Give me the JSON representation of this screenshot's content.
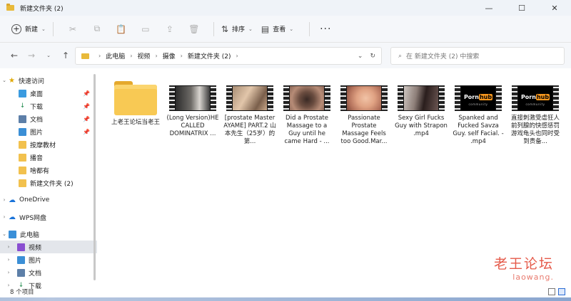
{
  "window": {
    "title": "新建文件夹 (2)",
    "controls": [
      "—",
      "☐",
      "✕"
    ]
  },
  "toolbar": {
    "new_label": "新建",
    "sort_label": "排序",
    "view_label": "查看",
    "more": "···"
  },
  "address": {
    "crumbs": [
      "此电脑",
      "视频",
      "摄像",
      "新建文件夹 (2)"
    ],
    "search_placeholder": "在 新建文件夹 (2) 中搜索"
  },
  "sidebar": {
    "quick_access": "快速访问",
    "items": [
      {
        "label": "桌面",
        "pinned": true
      },
      {
        "label": "下载",
        "pinned": true
      },
      {
        "label": "文档",
        "pinned": true
      },
      {
        "label": "图片",
        "pinned": true
      },
      {
        "label": "按摩教材"
      },
      {
        "label": "播音"
      },
      {
        "label": "啥都有"
      },
      {
        "label": "新建文件夹 (2)"
      }
    ],
    "onedrive": "OneDrive",
    "wps": "WPS网盘",
    "this_pc": "此电脑",
    "pc_items": [
      "视频",
      "图片",
      "文档",
      "下载"
    ]
  },
  "files": [
    {
      "name": "上老王论坛当老王",
      "type": "folder"
    },
    {
      "name": "(Long Version)HE CALLED DOMINATRIX ...",
      "type": "video"
    },
    {
      "name": "[prostate Master AYAME] PART.2 山本先生（25岁）的第...",
      "type": "video"
    },
    {
      "name": "Did a Prostate Massage to a Guy until he came Hard - ...",
      "type": "video"
    },
    {
      "name": "Passionate Prostate Massage Feels too Good.Mar...",
      "type": "video"
    },
    {
      "name": "Sexy Girl Fucks Guy with Strapon .mp4",
      "type": "video"
    },
    {
      "name": "Spanked and Fucked Savza Guy. self Facial. - .mp4",
      "type": "video",
      "brand": "Porn hub"
    },
    {
      "name": "直接刺激受虐狂人前列腺的快感惩罚游戏龟头也同时受到责备...",
      "type": "video",
      "brand": "Porn hub"
    }
  ],
  "brand": {
    "porn": "Porn",
    "hub": "hub",
    "sub": "community"
  },
  "status": {
    "count": "8 个项目"
  },
  "watermark": {
    "line1": "老王论坛",
    "line2": "laowang."
  }
}
